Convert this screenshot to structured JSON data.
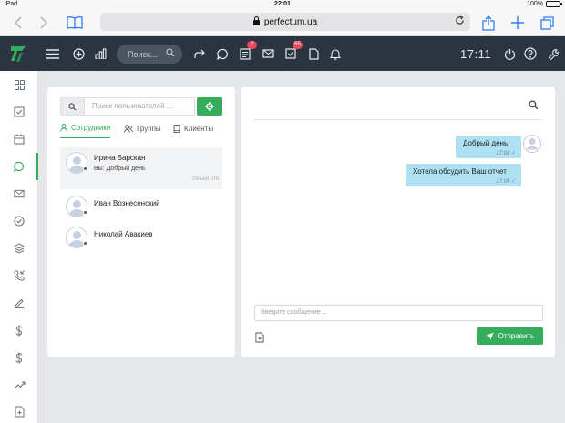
{
  "status_bar": {
    "device": "iPad",
    "time": "22:01",
    "battery": "100%"
  },
  "browser": {
    "url": "perfectum.ua"
  },
  "header": {
    "search_placeholder": "Поиск...",
    "badges": {
      "tasks": "2",
      "checklist": "55"
    },
    "clock": "17:11"
  },
  "contacts": {
    "search_placeholder": "Поиск пользователей ...",
    "tabs": [
      {
        "label": "Сотрудники"
      },
      {
        "label": "Группы"
      },
      {
        "label": "Клиенты"
      }
    ],
    "users": [
      {
        "name": "Ирина Барская",
        "last_message": "Вы: Добрый день",
        "time": "только что"
      },
      {
        "name": "Иван Вознесенский",
        "last_message": "",
        "time": ""
      },
      {
        "name": "Николай Авакиев",
        "last_message": "",
        "time": ""
      }
    ]
  },
  "chat": {
    "messages": [
      {
        "text": "Добрый день",
        "time": "17:08"
      },
      {
        "text": "Хотела обсудить Ваш отчет",
        "time": "17:09"
      }
    ],
    "compose_placeholder": "Введите сообщение ...",
    "send_label": "Отправить"
  },
  "colors": {
    "accent": "#35ad5c",
    "header_bg": "#2b3541",
    "bubble": "#aee1f2",
    "badge": "#ea4b5c"
  }
}
